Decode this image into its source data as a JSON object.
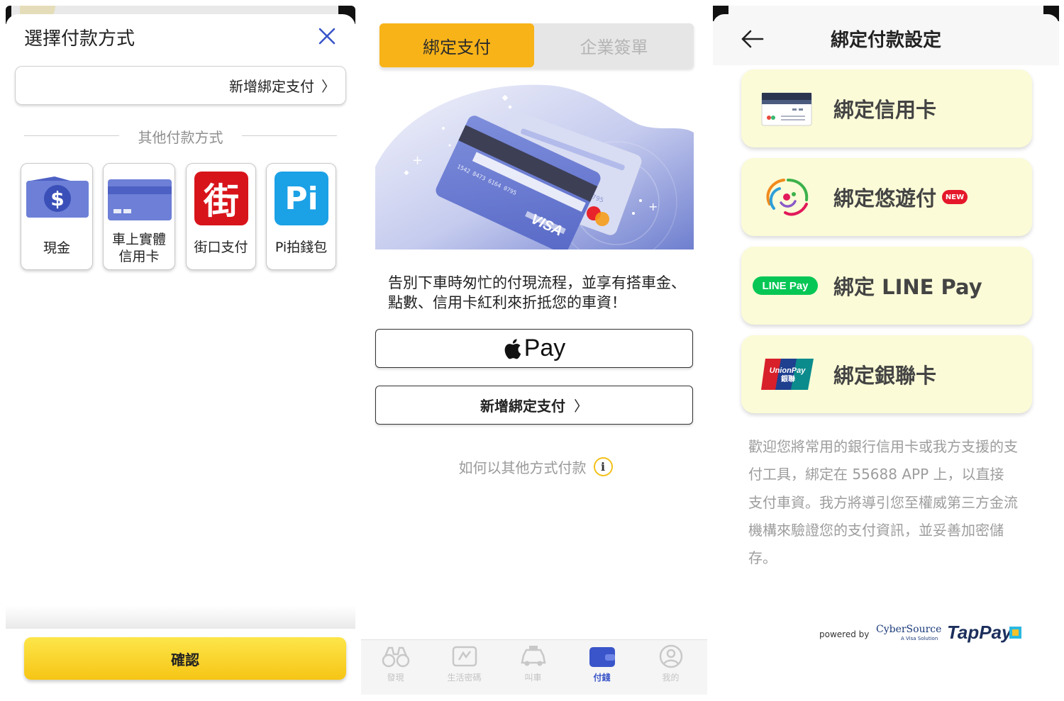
{
  "panel1": {
    "title": "選擇付款方式",
    "add_bind_label": "新增綁定支付",
    "add_bind_chevron": "〉",
    "other_methods_label": "其他付款方式",
    "methods": [
      {
        "label": "現金",
        "icon": "cash-icon"
      },
      {
        "label": "車上實體\n信用卡",
        "icon": "credit-card-icon"
      },
      {
        "label": "街口支付",
        "icon": "jko-pay-icon"
      },
      {
        "label": "Pi拍錢包",
        "icon": "pi-wallet-icon"
      }
    ],
    "jko_glyph": "街",
    "pi_glyph": "Pi",
    "confirm_label": "確認"
  },
  "panel2": {
    "tabs": [
      {
        "label": "綁定支付",
        "active": true
      },
      {
        "label": "企業簽單",
        "active": false
      }
    ],
    "card_number": "1542 8473 6164 0795",
    "card_brand": "VISA",
    "card_small_number": "0795",
    "promo_text": "告別下車時匆忙的付現流程，並享有搭車金、點數、信用卡紅利來折抵您的車資！",
    "apple_pay_label": "Pay",
    "add_bind_label": "新增綁定支付",
    "add_bind_chevron": "〉",
    "how_to_label": "如何以其他方式付款",
    "info_glyph": "i",
    "nav": [
      {
        "label": "發現",
        "icon": "binoculars-icon",
        "active": false
      },
      {
        "label": "生活密碼",
        "icon": "ticket-icon",
        "active": false
      },
      {
        "label": "叫車",
        "icon": "taxi-icon",
        "active": false
      },
      {
        "label": "付錢",
        "icon": "wallet-icon",
        "active": true
      },
      {
        "label": "我的",
        "icon": "profile-icon",
        "active": false
      }
    ],
    "colors": {
      "tab_active": "#f8b318",
      "nav_active": "#3a55c9"
    }
  },
  "panel3": {
    "title": "綁定付款設定",
    "options": [
      {
        "label": "綁定信用卡",
        "icon": "credit-card-icon"
      },
      {
        "label": "綁定悠遊付",
        "icon": "easywallet-icon",
        "badge": "NEW"
      },
      {
        "label": "綁定 LINE Pay",
        "icon": "line-pay-icon"
      },
      {
        "label": "綁定銀聯卡",
        "icon": "unionpay-icon"
      }
    ],
    "linepay_logo_text": "LINE Pay",
    "unionpay_logo_text": "UnionPay",
    "unionpay_logo_sub": "銀聯",
    "description": "歡迎您將常用的銀行信用卡或我方支援的支付工具，綁定在 55688 APP 上，以直接支付車資。我方將導引您至權威第三方金流機構來驗證您的支付資訊，並妥善加密儲存。",
    "powered_by": "powered by",
    "cybersource": "CyberSource",
    "cybersource_sub": "A Visa Solution",
    "tappay": "TapPay",
    "colors": {
      "card_bg": "#fbfbd7",
      "new_badge": "#e5172a"
    }
  }
}
